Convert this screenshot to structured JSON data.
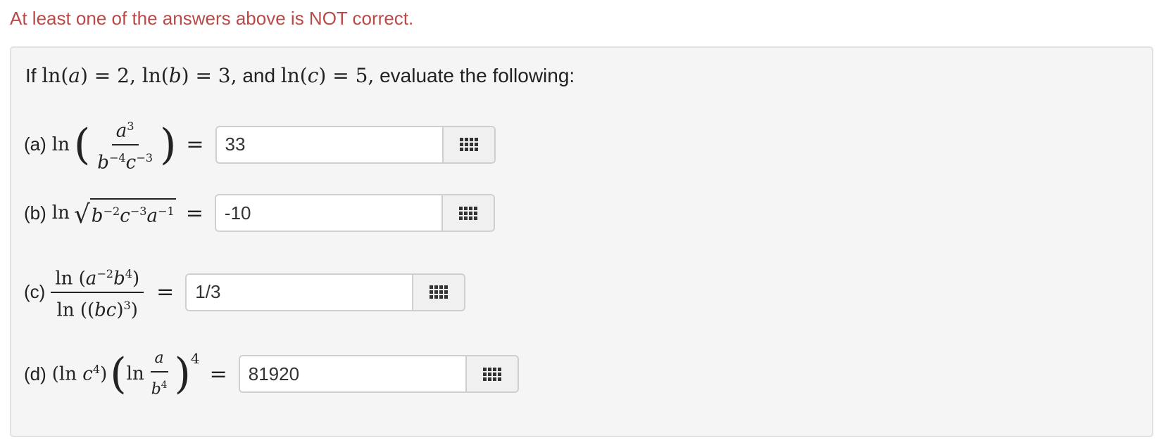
{
  "feedback": {
    "warning": "At least one of the answers above is NOT correct."
  },
  "problem": {
    "intro_prefix": "If",
    "intro_ln": "ln",
    "intro_and": "and",
    "intro_suffix": "evaluate the following:",
    "parts": [
      {
        "label": "(a)",
        "answer": "33"
      },
      {
        "label": "(b)",
        "answer": "-10"
      },
      {
        "label": "(c)",
        "answer": "1/3"
      },
      {
        "label": "(d)",
        "answer": "81920"
      }
    ]
  },
  "icons": {
    "palette": "grid-icon"
  }
}
